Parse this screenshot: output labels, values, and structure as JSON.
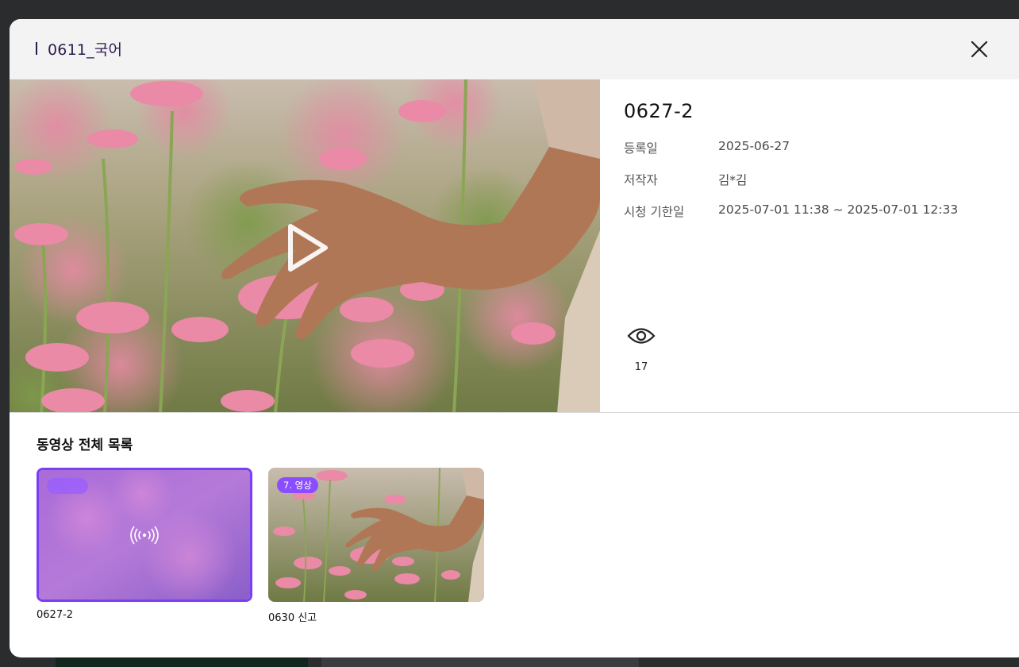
{
  "modal": {
    "title": "0611_국어",
    "close_icon": "close-icon"
  },
  "player": {
    "play_icon": "play-icon"
  },
  "details": {
    "video_title": "0627-2",
    "registered_label": "등록일",
    "registered_value": "2025-06-27",
    "author_label": "저작자",
    "author_value": "김*김",
    "period_label": "시청 기한일",
    "period_value": "2025-07-01 11:38 ~ 2025-07-01 12:33",
    "views_icon": "eye-icon",
    "views_count": "17"
  },
  "video_list": {
    "title": "동영상 전체 목록",
    "items": [
      {
        "label": "0627-2",
        "badge": "",
        "selected": true,
        "icon": "live-broadcast-icon"
      },
      {
        "label": "0630 신고",
        "badge": "7. 영상",
        "selected": false
      }
    ]
  },
  "colors": {
    "accent": "#7b3ff2",
    "badge": "#8a4dff",
    "header_bg": "#f3f3f3",
    "title_text": "#2a1b4f"
  }
}
